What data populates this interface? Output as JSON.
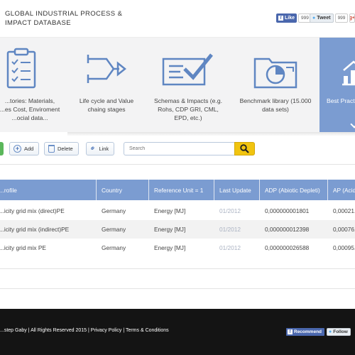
{
  "header": {
    "title": "GLOBAL INDUSTRIAL PROCESS & IMPACT DATABASE",
    "social": {
      "fb_like": "Like",
      "fb_count": "999",
      "tweet": "Tweet",
      "tweet_count": "999",
      "gplus": "g+"
    }
  },
  "categories": [
    {
      "label": "...tories: Materials, ...es Cost, Enviroment ...ocial data...",
      "icon": "clipboard-checklist-icon"
    },
    {
      "label": "Life cycle and Value chaing stages",
      "icon": "arrows-flow-icon"
    },
    {
      "label": "Schemas & Impacts (e.g. Rohs, CDP GRI, CML, EPD, etc.)",
      "icon": "checked-document-icon"
    },
    {
      "label": "Benchmark library (15.000 data sets)",
      "icon": "folder-chart-icon"
    },
    {
      "label": "Best Practi...",
      "icon": "growth-chart-icon"
    }
  ],
  "toolbar": {
    "add": "Add",
    "delete": "Delete",
    "link": "Link",
    "search_placeholder": "Search"
  },
  "table": {
    "headers": [
      "...rofile",
      "Country",
      "Reference Unit = 1",
      "Last Update",
      "ADP (Abiotic Depleti)",
      "AP (Acidi..."
    ],
    "rows": [
      [
        "...icity grid mix (direct)PE",
        "Germany",
        "Energy [MJ]",
        "01/2012",
        "0,000000001801",
        "0,00021..."
      ],
      [
        "...icity grid mix (indirect)PE",
        "Germany",
        "Energy [MJ]",
        "01/2012",
        "0,000000012398",
        "0,00076..."
      ],
      [
        "...icity grid mix PE",
        "Germany",
        "Energy [MJ]",
        "01/2012",
        "0,000000026588",
        "0,00095..."
      ]
    ]
  },
  "footer": {
    "copyright": "...step Gaby | All Rights Reserved 2015",
    "privacy": "Privacy Policy",
    "terms": "Terms & Conditions",
    "recommend": "Recommend",
    "follow": "Follow"
  },
  "colors": {
    "accent_blue": "#7b9cd1",
    "search_yellow": "#f1c40f",
    "footer_bg": "#141414",
    "green": "#5bb75b"
  }
}
